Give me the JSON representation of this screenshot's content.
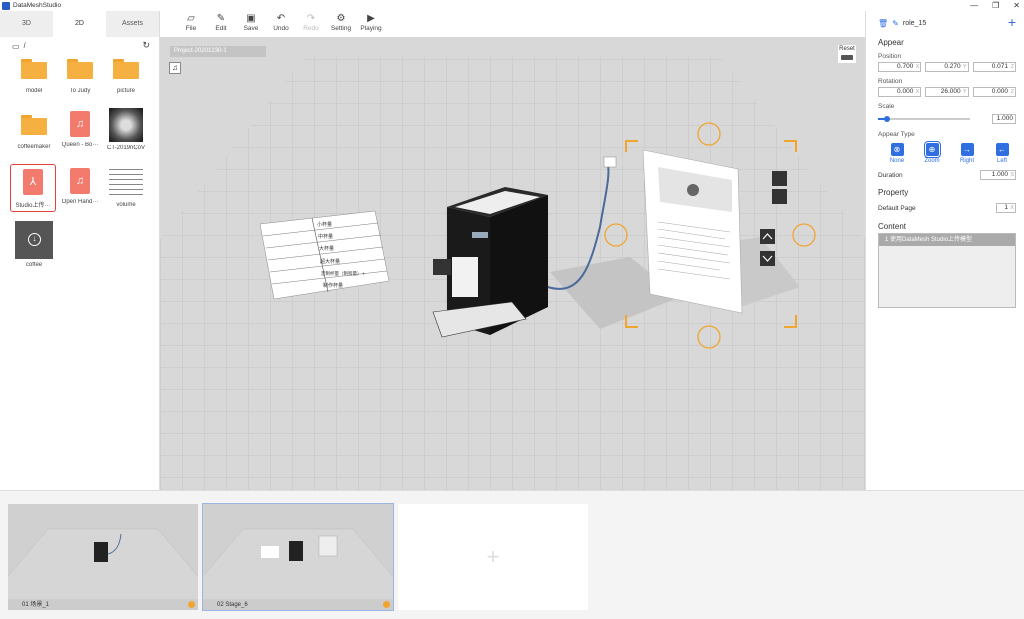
{
  "app": {
    "title": "DataMeshStudio"
  },
  "left_tabs": [
    "3D",
    "2D",
    "Assets"
  ],
  "path": "/",
  "assets": [
    {
      "label": "model",
      "kind": "folder"
    },
    {
      "label": "To Judy",
      "kind": "folder"
    },
    {
      "label": "picture",
      "kind": "folder"
    },
    {
      "label": "coffeemaker",
      "kind": "folder"
    },
    {
      "label": "Queen - Bo···",
      "kind": "audio"
    },
    {
      "label": "CT-2019nCoV",
      "kind": "image"
    },
    {
      "label": "Studio上传···",
      "kind": "pdf",
      "selected": true
    },
    {
      "label": "Open Hand···",
      "kind": "audio"
    },
    {
      "label": "volume",
      "kind": "image"
    },
    {
      "label": "coffee",
      "kind": "image"
    }
  ],
  "toolbar": [
    {
      "label": "File",
      "icon": "folder-icon"
    },
    {
      "label": "Edit",
      "icon": "edit-icon"
    },
    {
      "label": "Save",
      "icon": "save-icon"
    },
    {
      "label": "Undo",
      "icon": "undo-icon"
    },
    {
      "label": "Redo",
      "icon": "redo-icon",
      "disabled": true
    },
    {
      "label": "Setting",
      "icon": "gear-icon"
    },
    {
      "label": "Playing",
      "icon": "play-icon"
    }
  ],
  "viewport": {
    "project_label": "Project-20201230-1",
    "reset_label": "Reset",
    "menu_rows": [
      "小杯量",
      "中杯量",
      "大杯量",
      "超大杯量",
      "定制杯量（制程量）+",
      "制作杯量"
    ]
  },
  "inspector": {
    "role_name": "role_15",
    "appear_title": "Appear",
    "position_label": "Position",
    "position": [
      "0.700",
      "0.270",
      "0.071"
    ],
    "rotation_label": "Rotation",
    "rotation": [
      "0.000",
      "26.000",
      "0.000"
    ],
    "axes": [
      "X",
      "Y",
      "Z"
    ],
    "scale_label": "Scale",
    "scale_value": "1.000",
    "scale_fraction": 0.08,
    "appear_type_label": "Appear Type",
    "appear_types": [
      "None",
      "Zoom",
      "Right",
      "Left"
    ],
    "duration_label": "Duration",
    "duration_value": "1.000",
    "duration_unit": "S",
    "property_title": "Property",
    "default_page_label": "Default Page",
    "default_page_value": "1",
    "default_page_unit": "X",
    "content_title": "Content",
    "content_items": [
      "1 使用DataMesh Studio上传模型"
    ]
  },
  "timeline": [
    {
      "label": "01 场景_1"
    },
    {
      "label": "02 Stage_6",
      "active": true
    }
  ]
}
